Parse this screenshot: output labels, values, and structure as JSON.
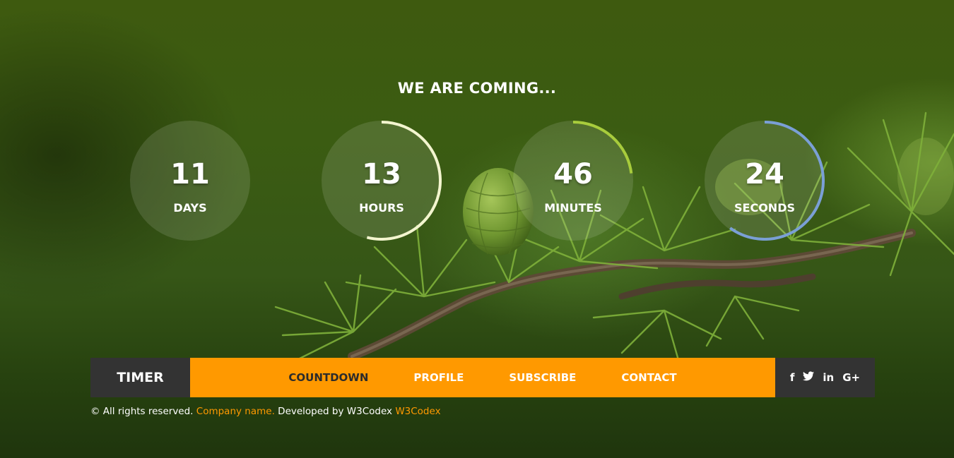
{
  "headline": "WE ARE COMING...",
  "timer": [
    {
      "value": "11",
      "label": "DAYS",
      "progress": 0,
      "ring_color": "#ffffff"
    },
    {
      "value": "13",
      "label": "HOURS",
      "progress": 0.54,
      "ring_color": "#f3f5cf"
    },
    {
      "value": "46",
      "label": "MINUTES",
      "progress": 0.23,
      "ring_color": "#a8cc3c"
    },
    {
      "value": "24",
      "label": "SECONDS",
      "progress": 0.6,
      "ring_color": "#7a9fd6"
    }
  ],
  "nav": {
    "brand": "TIMER",
    "items": [
      {
        "label": "COUNTDOWN",
        "active": true
      },
      {
        "label": "PROFILE",
        "active": false
      },
      {
        "label": "SUBSCRIBE",
        "active": false
      },
      {
        "label": "CONTACT",
        "active": false
      }
    ],
    "social": [
      {
        "icon": "facebook-icon",
        "glyph": "f"
      },
      {
        "icon": "twitter-icon",
        "glyph": "🐦"
      },
      {
        "icon": "linkedin-icon",
        "glyph": "in"
      },
      {
        "icon": "google-plus-icon",
        "glyph": "G+"
      }
    ]
  },
  "footer": {
    "copyright_symbol": "©",
    "rights": "All rights reserved.",
    "company": "Company name.",
    "developed_by": "Developed by W3Codex",
    "dev_link": "W3Codex"
  },
  "colors": {
    "accent": "#ff9900",
    "nav_dark": "#333333"
  }
}
